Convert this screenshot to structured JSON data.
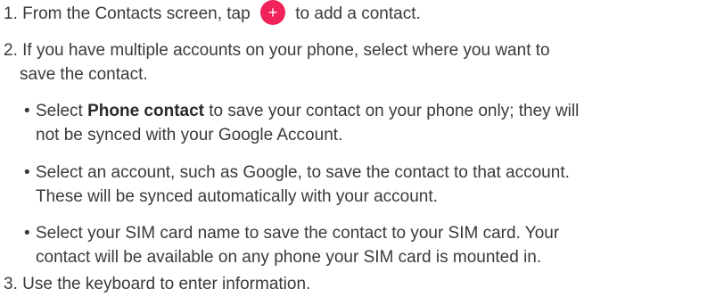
{
  "steps": [
    {
      "number": "1.",
      "text_before_icon": "From the Contacts screen, tap",
      "icon": "add-icon",
      "icon_glyph": "+",
      "text_after_icon": "to add a contact."
    },
    {
      "number": "2.",
      "line1": "If you have multiple accounts on your phone, select where you want to",
      "line2": "save the contact."
    },
    {
      "number": "3.",
      "text": "Use the keyboard to enter information."
    }
  ],
  "bullets": [
    {
      "lead": "Select ",
      "bold": "Phone contact",
      "line1_rest": " to save your contact on your phone only; they will",
      "line2": "not be synced with your Google Account."
    },
    {
      "line1": "Select an account, such as Google, to save the contact to that account.",
      "line2": "These will be synced automatically with your account."
    },
    {
      "line1": "Select your SIM card name to save the contact to your SIM card. Your",
      "line2": "contact will be available on any phone your SIM card is mounted in."
    }
  ],
  "bullet_glyph": "•",
  "colors": {
    "text": "#3a3a3a",
    "accent": "#f0225a"
  }
}
